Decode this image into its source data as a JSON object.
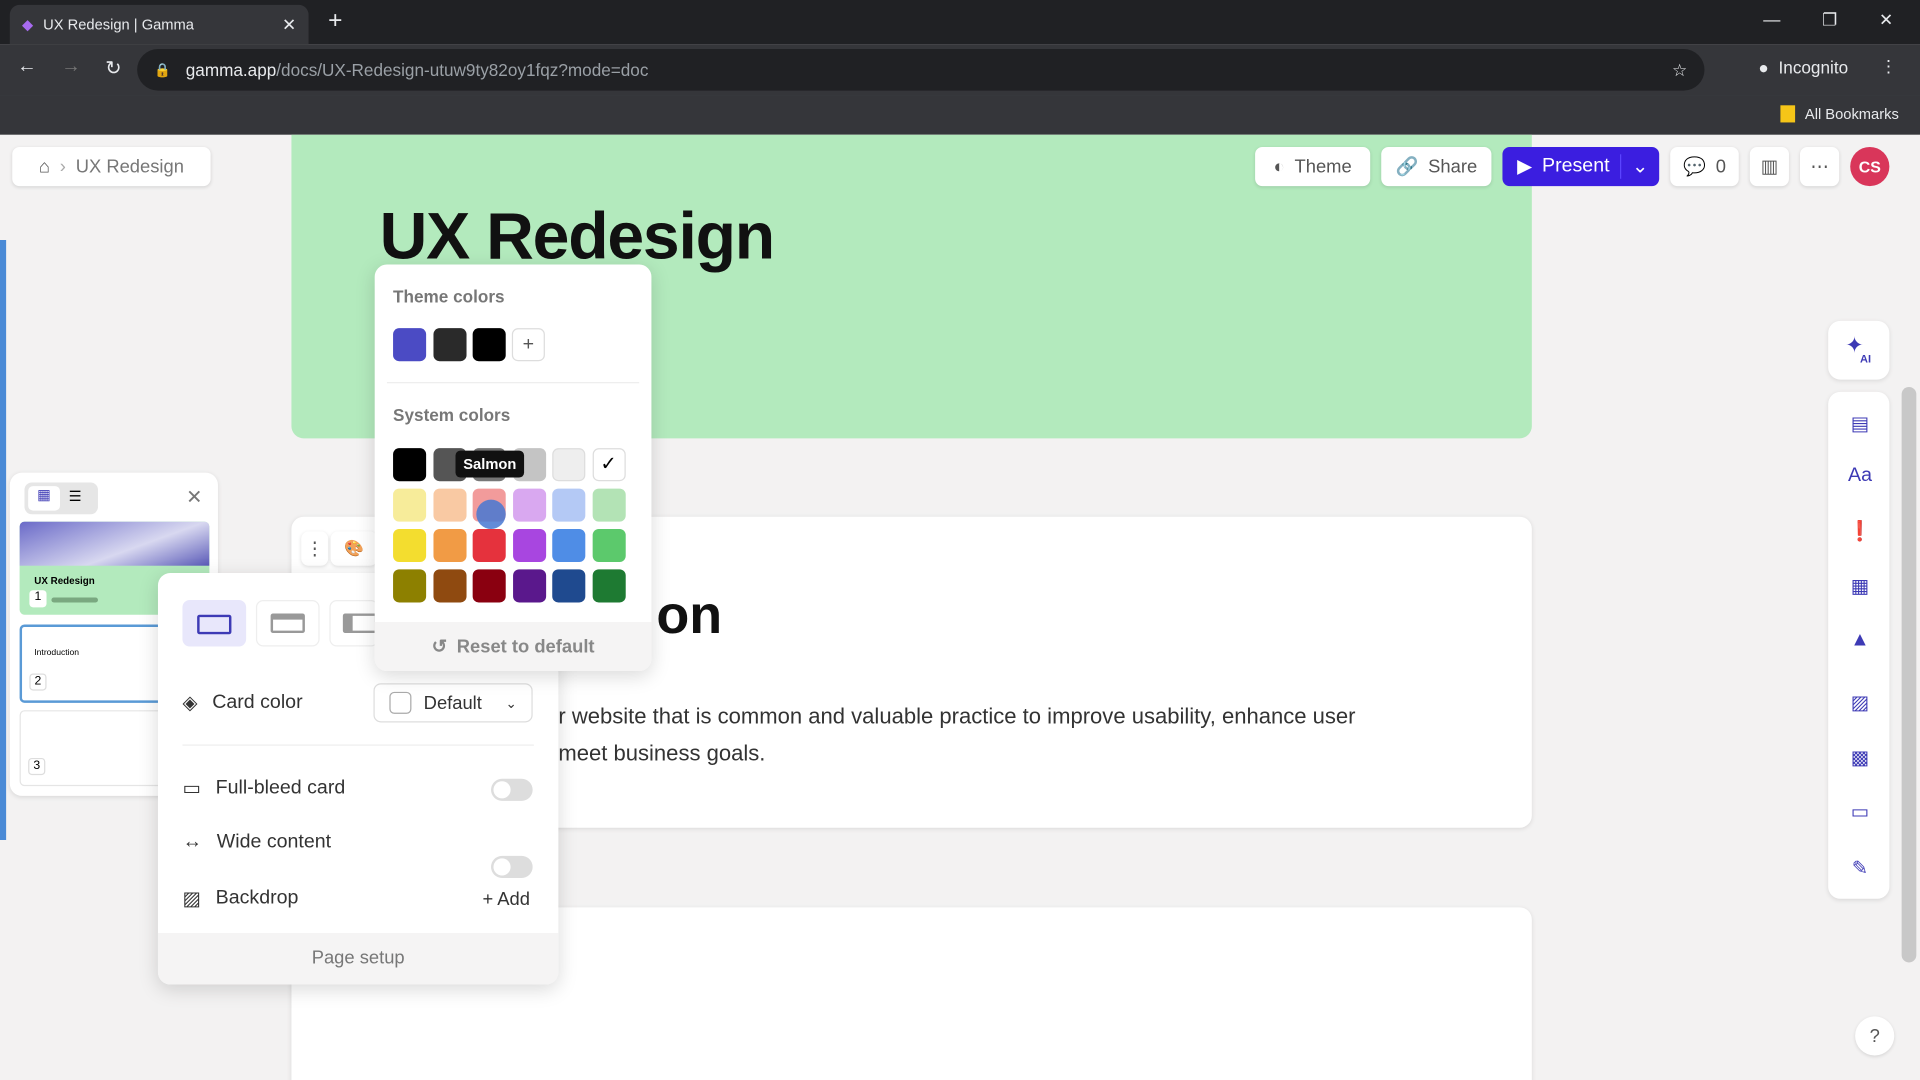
{
  "browser": {
    "tab_title": "UX Redesign | Gamma",
    "url_host": "gamma.app",
    "url_path": "/docs/UX-Redesign-utuw9ty82oy1fqz?mode=doc",
    "profile": "Incognito",
    "bookmarks": "All Bookmarks"
  },
  "toolbar": {
    "breadcrumb": "UX Redesign",
    "theme": "Theme",
    "share": "Share",
    "present": "Present",
    "comments": "0",
    "avatar": "CS"
  },
  "doc": {
    "title": "UX Redesign",
    "card2_title_partial": "on",
    "card2_line1": "r website that is common and valuable practice to improve usability, enhance user",
    "card2_line2": "meet business goals."
  },
  "color_picker": {
    "theme_heading": "Theme colors",
    "system_heading": "System colors",
    "tooltip": "Salmon",
    "reset": "Reset to default",
    "theme_colors": [
      "#4b4bc4",
      "#2a2a2a",
      "#000000"
    ],
    "system_colors": [
      [
        "#000000",
        "#555555",
        "#777777",
        "#c4c4c4",
        "#eeeeee",
        "#ffffff"
      ],
      [
        "#f7ec9a",
        "#f9c9a3",
        "#f29b9b",
        "#d9a8f0",
        "#b4c9f5",
        "#b3e3b5"
      ],
      [
        "#f3dd2f",
        "#f19b45",
        "#e5323d",
        "#a846e0",
        "#4f8de6",
        "#5cc96c"
      ],
      [
        "#8d8000",
        "#8f4a10",
        "#8a0010",
        "#5a188c",
        "#1f4a8f",
        "#1e7a32"
      ]
    ]
  },
  "card_settings": {
    "card_color_label": "Card color",
    "card_color_value": "Default",
    "full_bleed": "Full-bleed card",
    "wide": "Wide content",
    "backdrop": "Backdrop",
    "add": "+ Add",
    "page_setup": "Page setup",
    "full_bleed_on": false,
    "wide_on": false
  },
  "slides": [
    {
      "num": "1",
      "title": "UX Redesign"
    },
    {
      "num": "2",
      "title": "Introduction"
    },
    {
      "num": "3",
      "title": ""
    }
  ],
  "right_tools": {
    "ai": "AI"
  },
  "help": "?"
}
